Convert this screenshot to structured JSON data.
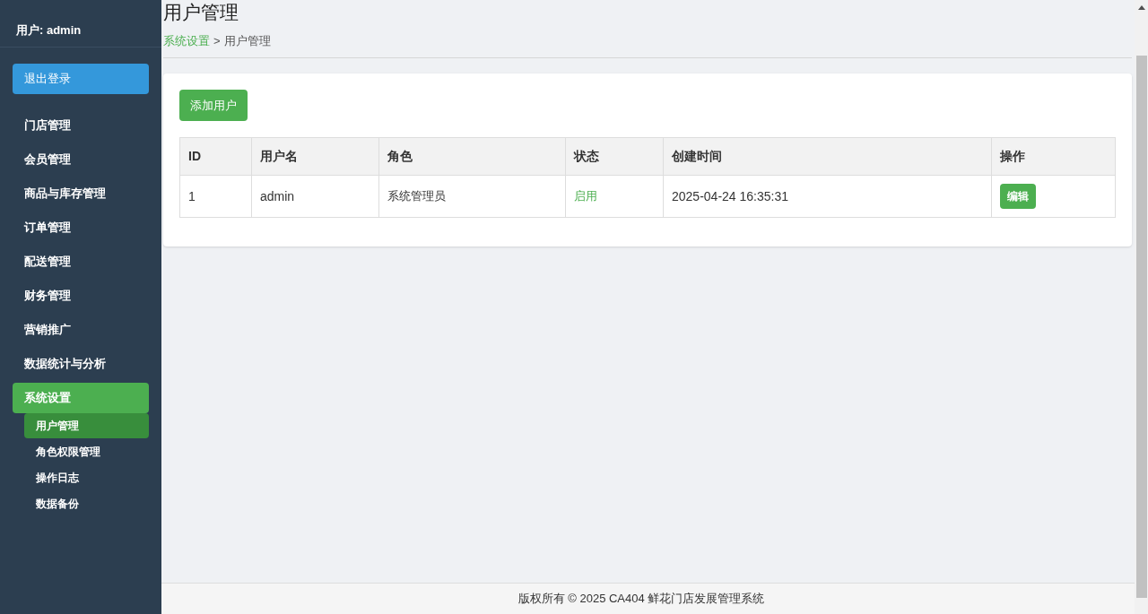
{
  "sidebar": {
    "user_label": "用户: admin",
    "logout_button": "退出登录",
    "items": [
      {
        "label": "门店管理",
        "selected": false
      },
      {
        "label": "会员管理",
        "selected": false
      },
      {
        "label": "商品与库存管理",
        "selected": false
      },
      {
        "label": "订单管理",
        "selected": false
      },
      {
        "label": "配送管理",
        "selected": false
      },
      {
        "label": "财务管理",
        "selected": false
      },
      {
        "label": "营销推广",
        "selected": false
      },
      {
        "label": "数据统计与分析",
        "selected": false
      },
      {
        "label": "系统设置",
        "selected": true,
        "expanded": true,
        "children": [
          {
            "label": "用户管理",
            "selected": true
          },
          {
            "label": "角色权限管理",
            "selected": false
          },
          {
            "label": "操作日志",
            "selected": false
          },
          {
            "label": "数据备份",
            "selected": false
          }
        ]
      }
    ]
  },
  "page": {
    "title": "用户管理",
    "breadcrumb": [
      {
        "label": "系统设置",
        "link": true
      },
      {
        "label": "用户管理",
        "link": false
      }
    ],
    "breadcrumb_separator": ">"
  },
  "add_button": "添加用户",
  "table": {
    "columns": [
      "ID",
      "用户名",
      "角色",
      "状态",
      "创建时间",
      "操作"
    ],
    "rows": [
      {
        "id": "1",
        "username": "admin",
        "role": "系统管理员",
        "status": "启用",
        "enabled": true,
        "created": "2025-04-24 16:35:31",
        "action": "编辑"
      }
    ]
  },
  "footer": "版权所有 © 2025 CA404 鲜花门店发展管理系统"
}
